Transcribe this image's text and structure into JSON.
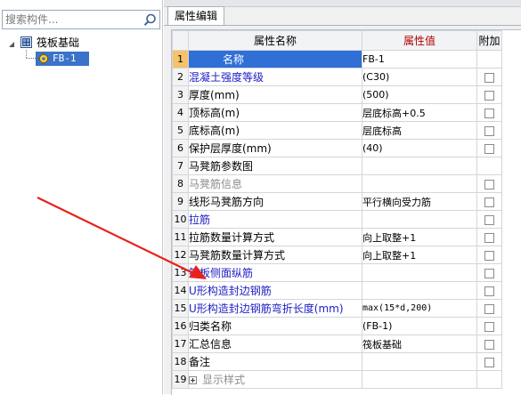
{
  "colors": {
    "selection_blue": "#2f6fd6",
    "header_value_bg": "#f6c36a",
    "header_value_text": "#b00000",
    "link_blue": "#1c1cc2",
    "arrow_red": "#e8211b"
  },
  "left": {
    "search": {
      "placeholder": "搜索构件...",
      "icon": "search-icon"
    },
    "tree": {
      "root_label": "筏板基础",
      "child_label": "FB-1"
    }
  },
  "right": {
    "tab_label": "属性编辑",
    "headers": {
      "num": "",
      "name": "属性名称",
      "value": "属性值",
      "add": "附加"
    },
    "rows": [
      {
        "num": "1",
        "name": "名称",
        "value": "FB-1",
        "checkbox": false,
        "style": "selected"
      },
      {
        "num": "2",
        "name": "混凝土强度等级",
        "value": "(C30)",
        "checkbox": true,
        "style": "blue"
      },
      {
        "num": "3",
        "name": "厚度(mm)",
        "value": "(500)",
        "checkbox": true,
        "style": "normal"
      },
      {
        "num": "4",
        "name": "顶标高(m)",
        "value": "层底标高+0.5",
        "checkbox": true,
        "style": "normal"
      },
      {
        "num": "5",
        "name": "底标高(m)",
        "value": "层底标高",
        "checkbox": true,
        "style": "normal"
      },
      {
        "num": "6",
        "name": "保护层厚度(mm)",
        "value": "(40)",
        "checkbox": true,
        "style": "normal"
      },
      {
        "num": "7",
        "name": "马凳筋参数图",
        "value": "",
        "checkbox": false,
        "style": "normal"
      },
      {
        "num": "8",
        "name": "马凳筋信息",
        "value": "",
        "checkbox": true,
        "style": "gray"
      },
      {
        "num": "9",
        "name": "线形马凳筋方向",
        "value": "平行横向受力筋",
        "checkbox": true,
        "style": "normal"
      },
      {
        "num": "10",
        "name": "拉筋",
        "value": "",
        "checkbox": true,
        "style": "blue"
      },
      {
        "num": "11",
        "name": "拉筋数量计算方式",
        "value": "向上取整+1",
        "checkbox": true,
        "style": "normal"
      },
      {
        "num": "12",
        "name": "马凳筋数量计算方式",
        "value": "向上取整+1",
        "checkbox": true,
        "style": "normal"
      },
      {
        "num": "13",
        "name": "筏板侧面纵筋",
        "value": "",
        "checkbox": true,
        "style": "blue"
      },
      {
        "num": "14",
        "name": "U形构造封边钢筋",
        "value": "",
        "checkbox": true,
        "style": "blue"
      },
      {
        "num": "15",
        "name": "U形构造封边钢筋弯折长度(mm)",
        "value": "max(15*d,200)",
        "checkbox": true,
        "style": "blue"
      },
      {
        "num": "16",
        "name": "归类名称",
        "value": "(FB-1)",
        "checkbox": true,
        "style": "normal"
      },
      {
        "num": "17",
        "name": "汇总信息",
        "value": "筏板基础",
        "checkbox": true,
        "style": "normal"
      },
      {
        "num": "18",
        "name": "备注",
        "value": "",
        "checkbox": true,
        "style": "normal"
      },
      {
        "num": "19",
        "name": "显示样式",
        "value": "",
        "checkbox": false,
        "style": "expandable"
      }
    ]
  }
}
